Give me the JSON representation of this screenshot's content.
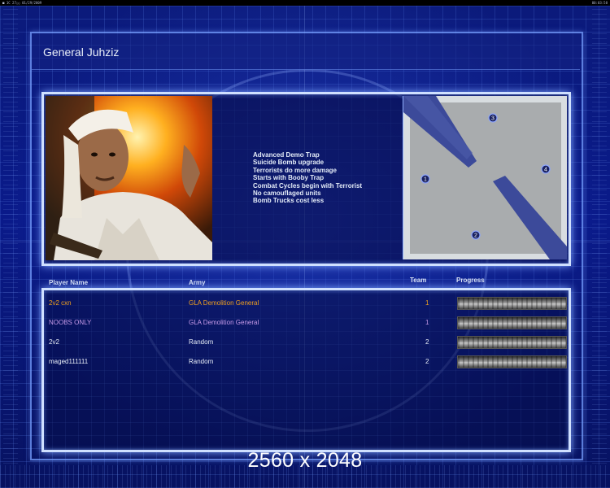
{
  "topbar": {
    "left_text": "■ 1C 27○○ 01/29/2009",
    "right_text": "00:03:58"
  },
  "general_name": "General Juhziz",
  "rules": [
    "Advanced Demo Trap",
    "Suicide Bomb upgrade",
    "Terrorists do more damage",
    "Starts with Booby Trap",
    "Combat Cycles begin with Terrorist",
    "No camouflaged units",
    "Bomb Trucks cost less"
  ],
  "minimap": {
    "start_positions": [
      "1",
      "2",
      "3",
      "4"
    ]
  },
  "table": {
    "headers": {
      "player": "Player Name",
      "army": "Army",
      "team": "Team",
      "progress": "Progress"
    },
    "rows": [
      {
        "name": "2v2 cxn",
        "army": "GLA Demolition General",
        "team": "1",
        "color": "#f0a020",
        "progress": 1.0
      },
      {
        "name": "NOOBS ONLY",
        "army": "GLA Demolition General",
        "team": "1",
        "color": "#c69ae8",
        "progress": 1.0
      },
      {
        "name": "2v2",
        "army": "Random",
        "team": "2",
        "color": "#e8eef8",
        "progress": 1.0
      },
      {
        "name": "maged111111",
        "army": "Random",
        "team": "2",
        "color": "#e8eef8",
        "progress": 1.0
      }
    ]
  },
  "resolution_label": "2560 x 2048"
}
